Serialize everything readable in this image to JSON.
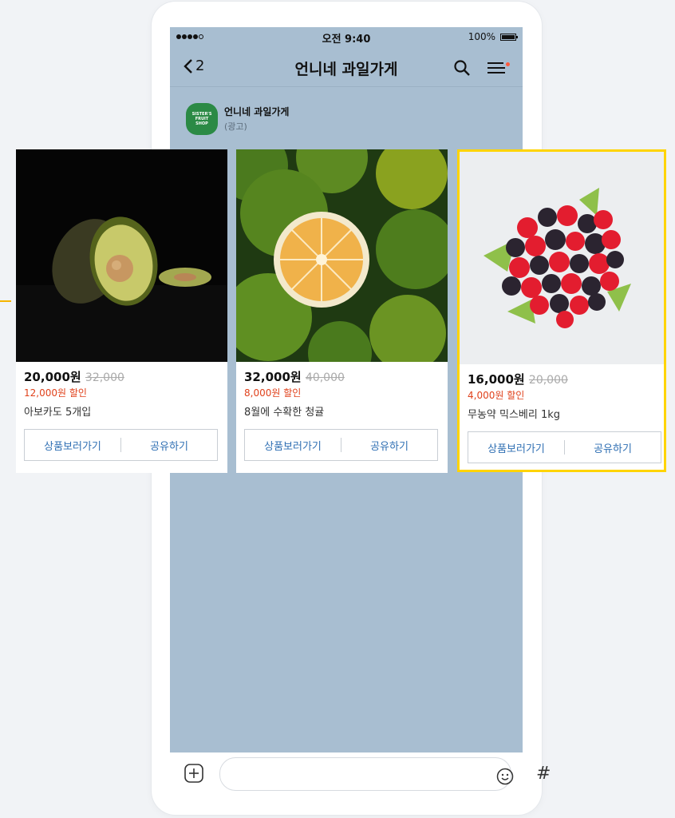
{
  "status_bar": {
    "time": "오전 9:40",
    "battery": "100%"
  },
  "header": {
    "back_count": "2",
    "title": "언니네 과일가게"
  },
  "sender": {
    "logo_lines": [
      "SISTER'S",
      "FRUIT",
      "SHOP"
    ],
    "name": "언니네 과일가게",
    "tag": "(광고)"
  },
  "products": [
    {
      "price": "20,000원",
      "original_price": "32,000",
      "discount": "12,000원 할인",
      "name": "아보카도 5개입",
      "view_button": "상품보러가기",
      "share_button": "공유하기"
    },
    {
      "price": "32,000원",
      "original_price": "40,000",
      "discount": "8,000원 할인",
      "name": "8월에 수확한 청귤",
      "view_button": "상품보러가기",
      "share_button": "공유하기"
    },
    {
      "price": "16,000원",
      "original_price": "20,000",
      "discount": "4,000원 할인",
      "name": "무농약 믹스베리 1kg",
      "view_button": "상품보러가기",
      "share_button": "공유하기"
    }
  ],
  "input_bar": {
    "hash": "#"
  },
  "colors": {
    "chat_background": "#a8bed1",
    "discount_red": "#e0411b",
    "button_blue": "#2f6fb3",
    "highlight_yellow": "#ffd400",
    "logo_green": "#2b8a45"
  }
}
